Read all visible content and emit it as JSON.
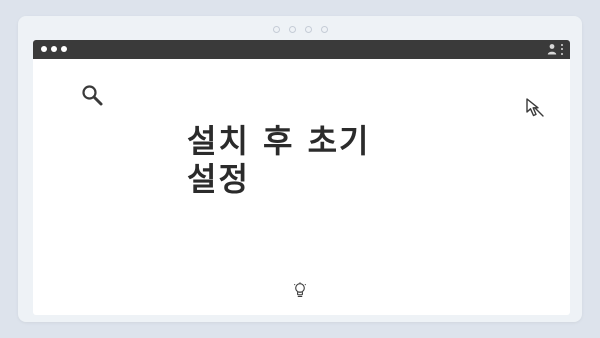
{
  "pager": {
    "dots": [
      1,
      2,
      3,
      4
    ]
  },
  "window": {
    "traffic_lights": [
      "close",
      "minimize",
      "maximize"
    ],
    "actions": [
      "user-icon",
      "more-options-icon"
    ]
  },
  "slide": {
    "title": "설치 후 초기 설정"
  },
  "icons": {
    "top_left": "search-icon",
    "top_right": "cursor-icon",
    "bottom_center": "lightbulb-icon"
  },
  "colors": {
    "background": "#dde3ec",
    "frame": "#eef2f6",
    "titlebar": "#3a3a3a",
    "window": "#ffffff",
    "title_text": "#2b2b2b"
  }
}
